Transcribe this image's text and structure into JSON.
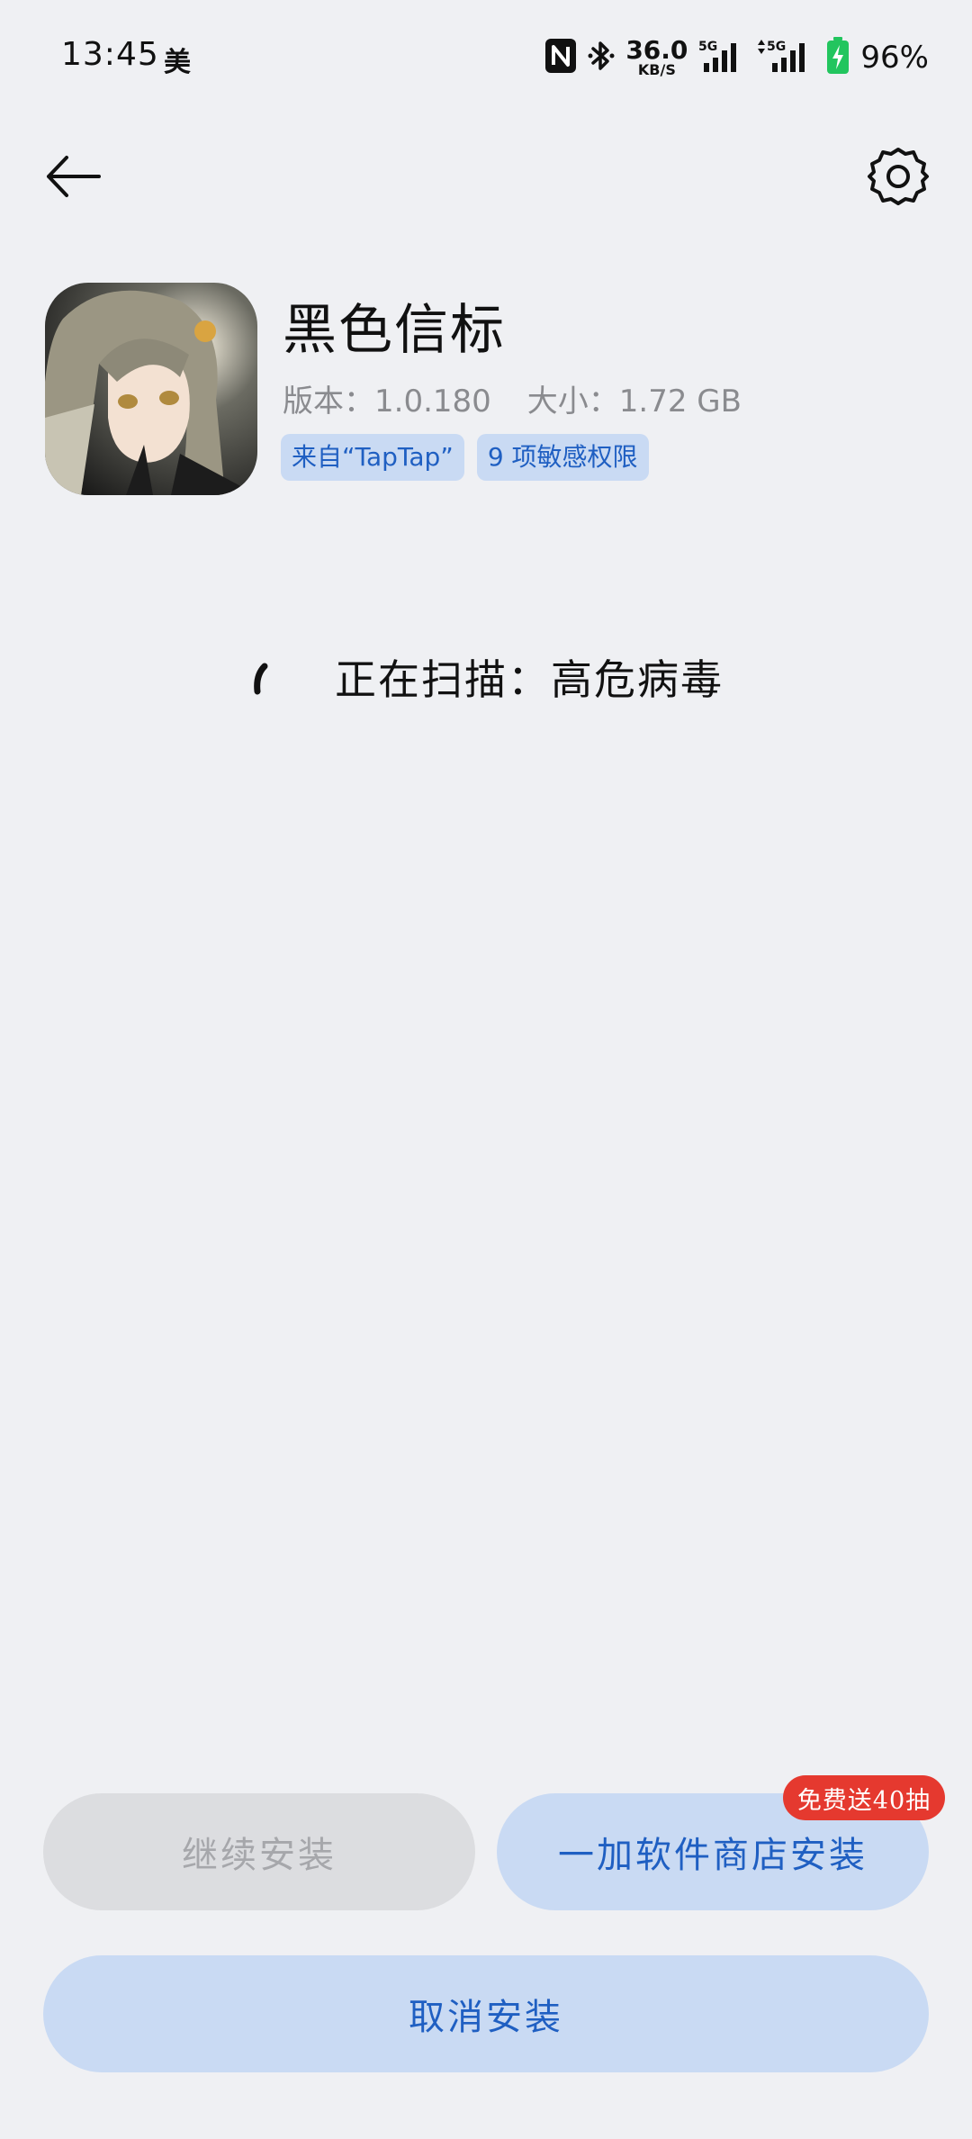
{
  "status_bar": {
    "time": "13:45",
    "carrier_badge": "美",
    "net_speed_value": "36.0",
    "net_speed_unit": "KB/S",
    "signal1_label": "5G",
    "signal2_label": "5G",
    "battery_percent": "96%",
    "battery_color": "#22c55e"
  },
  "nav": {
    "back_icon": "arrow-left-icon",
    "settings_icon": "gear-icon"
  },
  "app": {
    "name": "黑色信标",
    "version": "版本：1.0.180",
    "size": "大小：1.72 GB",
    "tags": [
      {
        "label": "来自“TapTap”"
      },
      {
        "label": "9 项敏感权限"
      }
    ]
  },
  "scan": {
    "status_text": "正在扫描：高危病毒"
  },
  "actions": {
    "continue_label": "继续安装",
    "store_label": "一加软件商店安装",
    "promo_label": "免费送40抽",
    "cancel_label": "取消安装"
  },
  "colors": {
    "accent_blue": "#1f5fc2",
    "button_blue_bg": "#c9daf3",
    "promo_red": "#e5392f"
  }
}
